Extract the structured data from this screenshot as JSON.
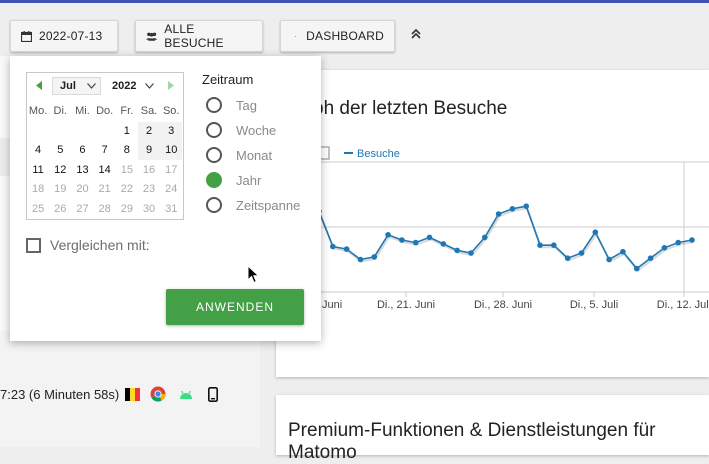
{
  "toolbar": {
    "date_button": "2022-07-13",
    "visits_button": "ALLE BESUCHE",
    "dashboard_button": "DASHBOARD"
  },
  "datepicker": {
    "month": "Jul",
    "year": "2022",
    "weekdays": [
      "Mo.",
      "Di.",
      "Mi.",
      "Do.",
      "Fr.",
      "Sa.",
      "So."
    ],
    "weeks": [
      [
        {
          "d": "",
          "s": "empty"
        },
        {
          "d": "",
          "s": "empty"
        },
        {
          "d": "",
          "s": "empty"
        },
        {
          "d": "",
          "s": "empty"
        },
        {
          "d": "1",
          "s": "cur"
        },
        {
          "d": "2",
          "s": "prev"
        },
        {
          "d": "3",
          "s": "prev"
        }
      ],
      [
        {
          "d": "4",
          "s": "cur"
        },
        {
          "d": "5",
          "s": "cur"
        },
        {
          "d": "6",
          "s": "cur"
        },
        {
          "d": "7",
          "s": "cur"
        },
        {
          "d": "8",
          "s": "cur"
        },
        {
          "d": "9",
          "s": "prev"
        },
        {
          "d": "10",
          "s": "prev"
        }
      ],
      [
        {
          "d": "11",
          "s": "cur"
        },
        {
          "d": "12",
          "s": "cur"
        },
        {
          "d": "13",
          "s": "cur"
        },
        {
          "d": "14",
          "s": "cur"
        },
        {
          "d": "15",
          "s": "dis"
        },
        {
          "d": "16",
          "s": "dis"
        },
        {
          "d": "17",
          "s": "dis"
        }
      ],
      [
        {
          "d": "18",
          "s": "dis"
        },
        {
          "d": "19",
          "s": "dis"
        },
        {
          "d": "20",
          "s": "dis"
        },
        {
          "d": "21",
          "s": "dis"
        },
        {
          "d": "22",
          "s": "dis"
        },
        {
          "d": "23",
          "s": "dis"
        },
        {
          "d": "24",
          "s": "dis"
        }
      ],
      [
        {
          "d": "25",
          "s": "dis"
        },
        {
          "d": "26",
          "s": "dis"
        },
        {
          "d": "27",
          "s": "dis"
        },
        {
          "d": "28",
          "s": "dis"
        },
        {
          "d": "29",
          "s": "dis"
        },
        {
          "d": "30",
          "s": "dis"
        },
        {
          "d": "31",
          "s": "dis"
        }
      ]
    ],
    "period_title": "Zeitraum",
    "periods": [
      {
        "label": "Tag",
        "selected": false
      },
      {
        "label": "Woche",
        "selected": false
      },
      {
        "label": "Monat",
        "selected": false
      },
      {
        "label": "Jahr",
        "selected": true
      },
      {
        "label": "Zeitspanne",
        "selected": false
      }
    ],
    "compare_label": "Vergleichen mit:",
    "apply_label": "ANWENDEN"
  },
  "graph_card": {
    "title": "ph der letzten Besuche",
    "legend": "Besuche",
    "chart_data": {
      "type": "line",
      "series": [
        {
          "name": "Besuche",
          "values": [
            0.62,
            0.35,
            0.33,
            0.25,
            0.27,
            0.44,
            0.4,
            0.38,
            0.42,
            0.37,
            0.32,
            0.3,
            0.42,
            0.6,
            0.64,
            0.66,
            0.36,
            0.36,
            0.26,
            0.3,
            0.46,
            0.25,
            0.31,
            0.18,
            0.26,
            0.34,
            0.38,
            0.4
          ]
        }
      ],
      "x_tick_labels": [
        "Juni",
        "Di., 21. Juni",
        "Di., 28. Juni",
        "Di., 5. Juli",
        "Di., 12. Juli"
      ]
    }
  },
  "premium_card": {
    "title": "Premium-Funktionen & Dienstleistungen für",
    "title_line2": "Matomo"
  },
  "visit_row": {
    "duration": "7:23 (6 Minuten 58s)"
  },
  "colors": {
    "accent_green": "#43a047",
    "line_blue": "#1f77b4",
    "topbar": "#3f51b5"
  }
}
